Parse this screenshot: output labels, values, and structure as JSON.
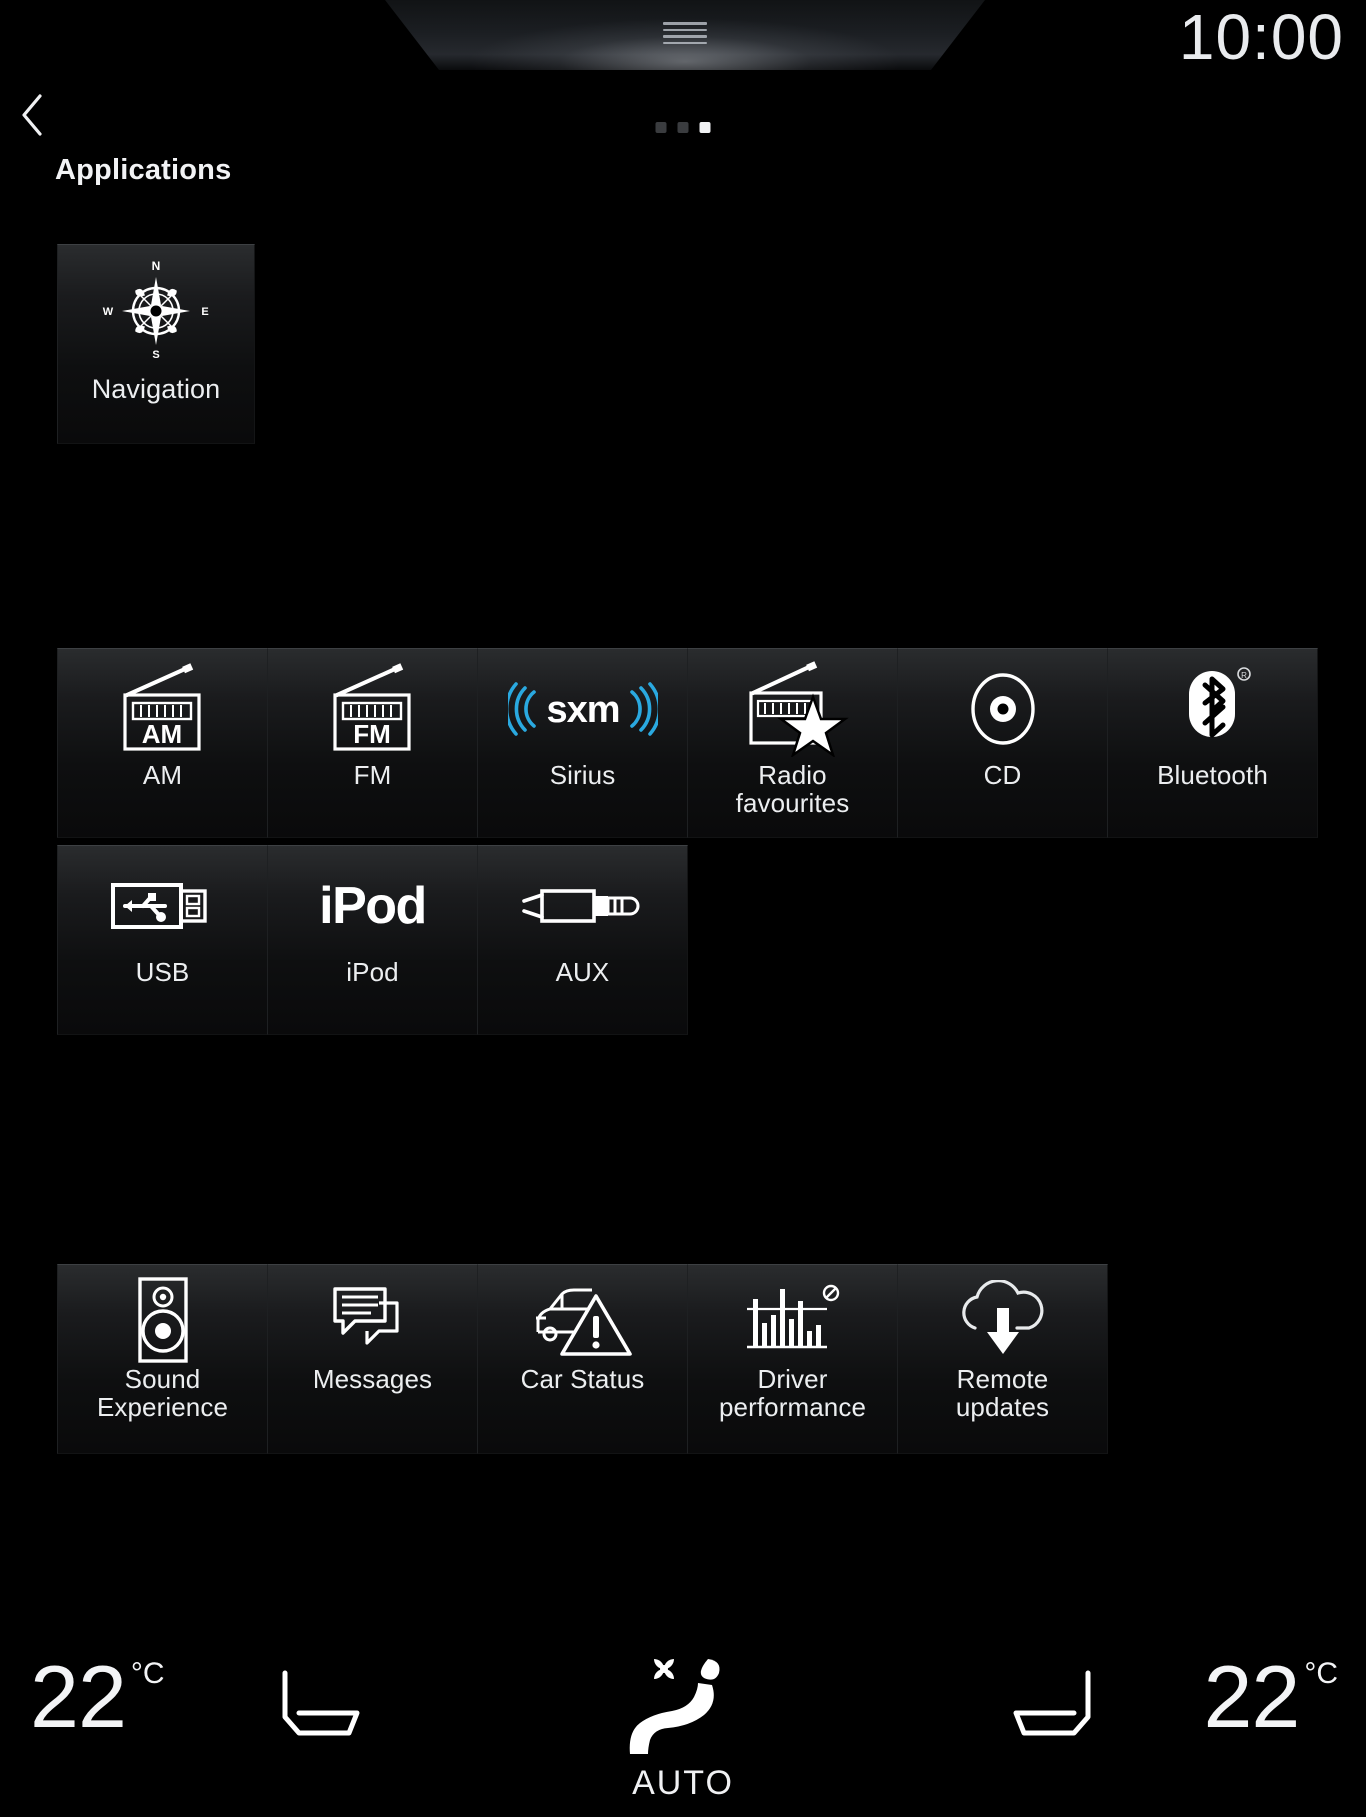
{
  "status": {
    "clock": "10:00",
    "page_dots": {
      "total": 3,
      "active_index": 2
    }
  },
  "header": {
    "back_icon": "chevron-left-icon",
    "title": "Applications"
  },
  "navigation_tile": {
    "label": "Navigation",
    "icon": "compass-rose-icon",
    "compass": {
      "n": "N",
      "e": "E",
      "s": "S",
      "w": "W"
    }
  },
  "media_row_1": [
    {
      "label": "AM",
      "icon": "radio-am-icon",
      "icon_text": "AM"
    },
    {
      "label": "FM",
      "icon": "radio-fm-icon",
      "icon_text": "FM"
    },
    {
      "label": "Sirius",
      "icon": "sxm-logo-icon",
      "icon_text": "sxm"
    },
    {
      "label": "Radio\nfavourites",
      "label_line1": "Radio",
      "label_line2": "favourites",
      "icon": "radio-star-favourites-icon"
    },
    {
      "label": "CD",
      "icon": "compact-disc-icon"
    },
    {
      "label": "Bluetooth",
      "icon": "bluetooth-icon"
    }
  ],
  "media_row_2": [
    {
      "label": "USB",
      "icon": "usb-connector-icon"
    },
    {
      "label": "iPod",
      "icon": "ipod-wordmark-icon",
      "icon_text": "iPod"
    },
    {
      "label": "AUX",
      "icon": "aux-jack-icon"
    }
  ],
  "app_row": [
    {
      "label": "Sound Experience",
      "label_line1": "Sound",
      "label_line2": "Experience",
      "icon": "speaker-icon"
    },
    {
      "label": "Messages",
      "icon": "chat-bubbles-icon"
    },
    {
      "label": "Car Status",
      "icon": "car-warning-icon"
    },
    {
      "label": "Driver performance",
      "label_line1": "Driver",
      "label_line2": "performance",
      "icon": "bar-chart-icon"
    },
    {
      "label": "Remote updates",
      "label_line1": "Remote",
      "label_line2": "updates",
      "icon": "cloud-download-icon"
    }
  ],
  "climate": {
    "left_temp_value": "22",
    "left_temp_unit": "°C",
    "right_temp_value": "22",
    "right_temp_unit": "°C",
    "left_seat_icon": "seat-icon",
    "right_seat_icon": "seat-icon",
    "auto_label": "AUTO",
    "auto_icon": "fan-seat-auto-icon"
  },
  "colors": {
    "background": "#000000",
    "text": "#eceef0",
    "tile_top": "#2a2c2e",
    "tile_bottom": "#0a0a0b",
    "accent_sxm_blue": "#2aa9e0",
    "dot_active": "#f0f1f3",
    "dot_inactive": "#3a3c3f"
  }
}
